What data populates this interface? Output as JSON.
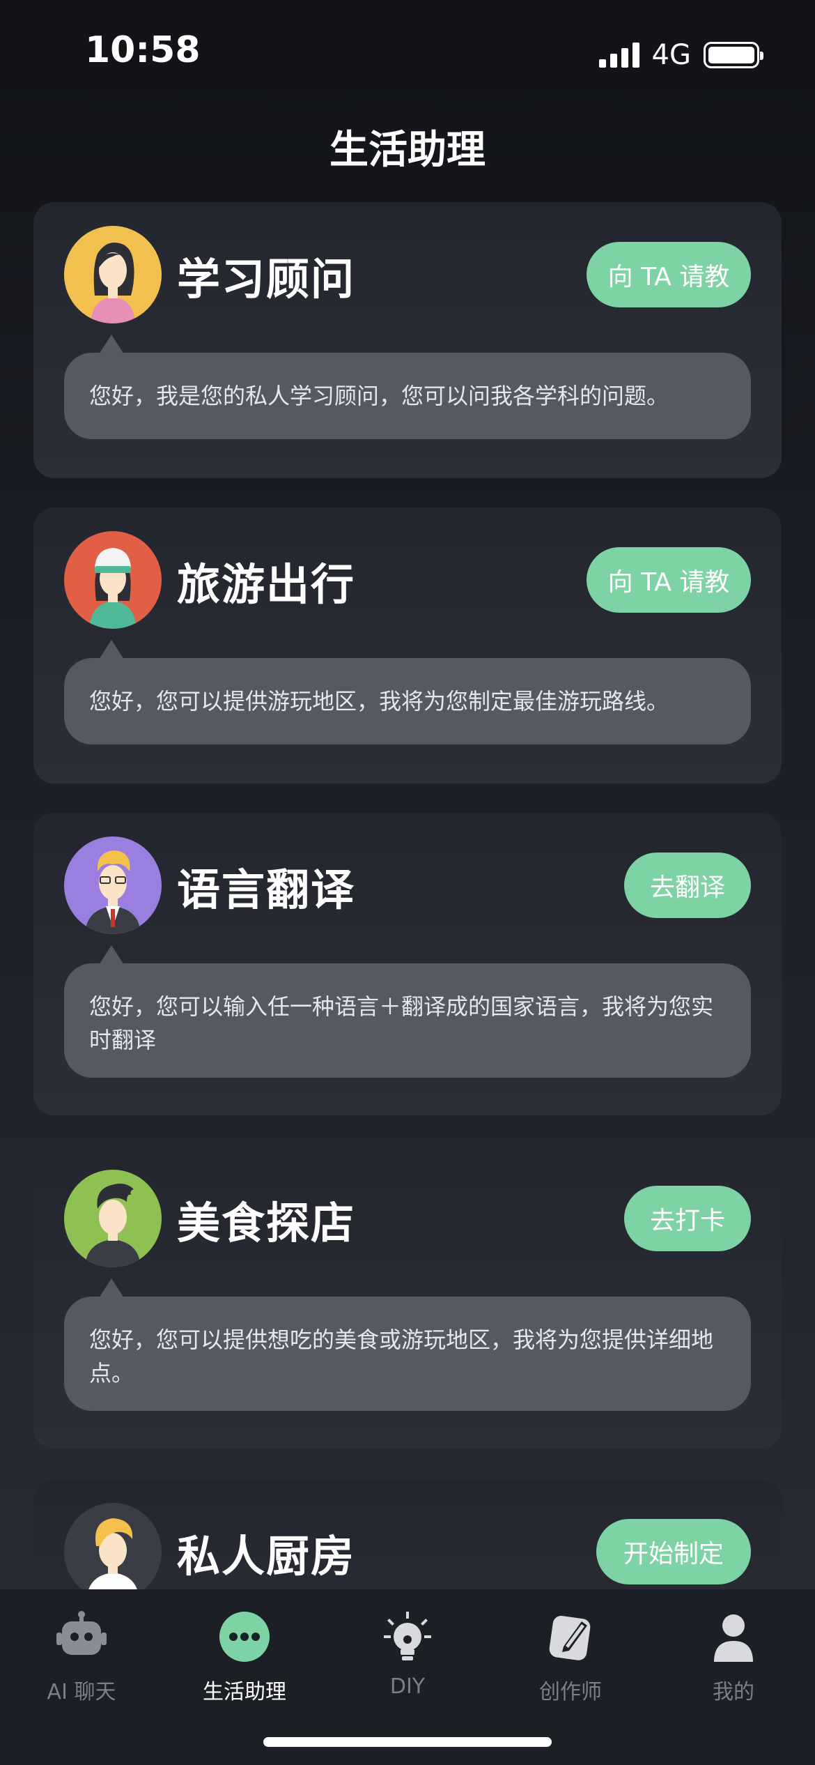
{
  "status": {
    "time": "10:58",
    "network": "4G"
  },
  "page": {
    "title": "生活助理"
  },
  "cards": [
    {
      "title": "学习顾问",
      "button": "向 TA 请教",
      "message": "您好，我是您的私人学习顾问，您可以问我各学科的问题。",
      "avatar_bg": "#f2c04f"
    },
    {
      "title": "旅游出行",
      "button": "向 TA 请教",
      "message": "您好，您可以提供游玩地区，我将为您制定最佳游玩路线。",
      "avatar_bg": "#e05f45"
    },
    {
      "title": "语言翻译",
      "button": "去翻译",
      "message": "您好，您可以输入任一种语言＋翻译成的国家语言，我将为您实时翻译",
      "avatar_bg": "#9a7fe0"
    },
    {
      "title": "美食探店",
      "button": "去打卡",
      "message": "您好，您可以提供想吃的美食或游玩地区，我将为您提供详细地点。",
      "avatar_bg": "#8fc152"
    },
    {
      "title": "私人厨房",
      "button": "开始制定",
      "message": "",
      "avatar_bg": "#3a3d46"
    }
  ],
  "tabs": [
    {
      "label": "AI 聊天",
      "icon": "robot-icon",
      "active": false
    },
    {
      "label": "生活助理",
      "icon": "more-dots-icon",
      "active": true
    },
    {
      "label": "DIY",
      "icon": "lightbulb-icon",
      "active": false
    },
    {
      "label": "创作师",
      "icon": "pen-icon",
      "active": false
    },
    {
      "label": "我的",
      "icon": "person-icon",
      "active": false
    }
  ],
  "colors": {
    "accent": "#7dd3a4",
    "bubble": "#565963",
    "card": "#2a2d36",
    "tab_inactive": "#7c7f88"
  }
}
